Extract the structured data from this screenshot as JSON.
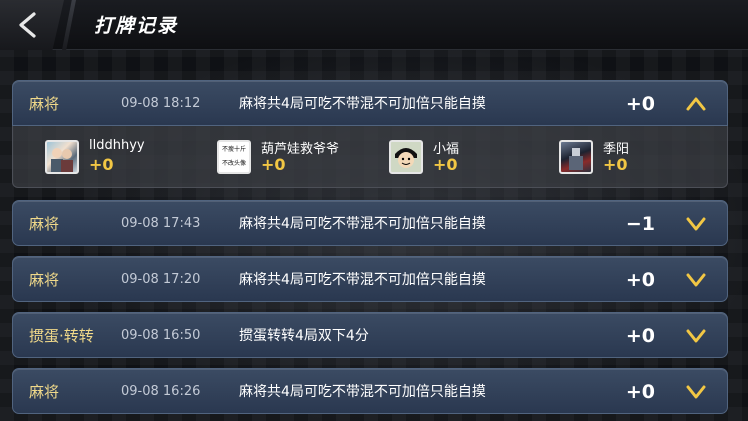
{
  "header": {
    "title": "打牌记录",
    "back_icon": "back-arrow-icon"
  },
  "colors": {
    "accent_gold": "#f2c744",
    "row_blue": "#34445c",
    "game_text": "#f0d98a"
  },
  "records": [
    {
      "game": "麻将",
      "time": "09-08 18:12",
      "desc": "麻将共4局可吃不带混不可加倍只能自摸",
      "score": "+0",
      "expanded": true,
      "players": [
        {
          "name": "llddhhyy",
          "score": "+0",
          "avatar": "photo-avatar"
        },
        {
          "name": "葫芦娃救爷爷",
          "score": "+0",
          "avatar": "text-avatar",
          "avatar_text": [
            "不瘦十斤",
            "不改头像"
          ]
        },
        {
          "name": "小福",
          "score": "+0",
          "avatar": "cartoon-avatar"
        },
        {
          "name": "季阳",
          "score": "+0",
          "avatar": "dark-photo-avatar"
        }
      ]
    },
    {
      "game": "麻将",
      "time": "09-08 17:43",
      "desc": "麻将共4局可吃不带混不可加倍只能自摸",
      "score": "−1",
      "expanded": false
    },
    {
      "game": "麻将",
      "time": "09-08 17:20",
      "desc": "麻将共4局可吃不带混不可加倍只能自摸",
      "score": "+0",
      "expanded": false
    },
    {
      "game": "掼蛋·转转",
      "time": "09-08 16:50",
      "desc": "掼蛋转转4局双下4分",
      "score": "+0",
      "expanded": false
    },
    {
      "game": "麻将",
      "time": "09-08 16:26",
      "desc": "麻将共4局可吃不带混不可加倍只能自摸",
      "score": "+0",
      "expanded": false
    }
  ]
}
